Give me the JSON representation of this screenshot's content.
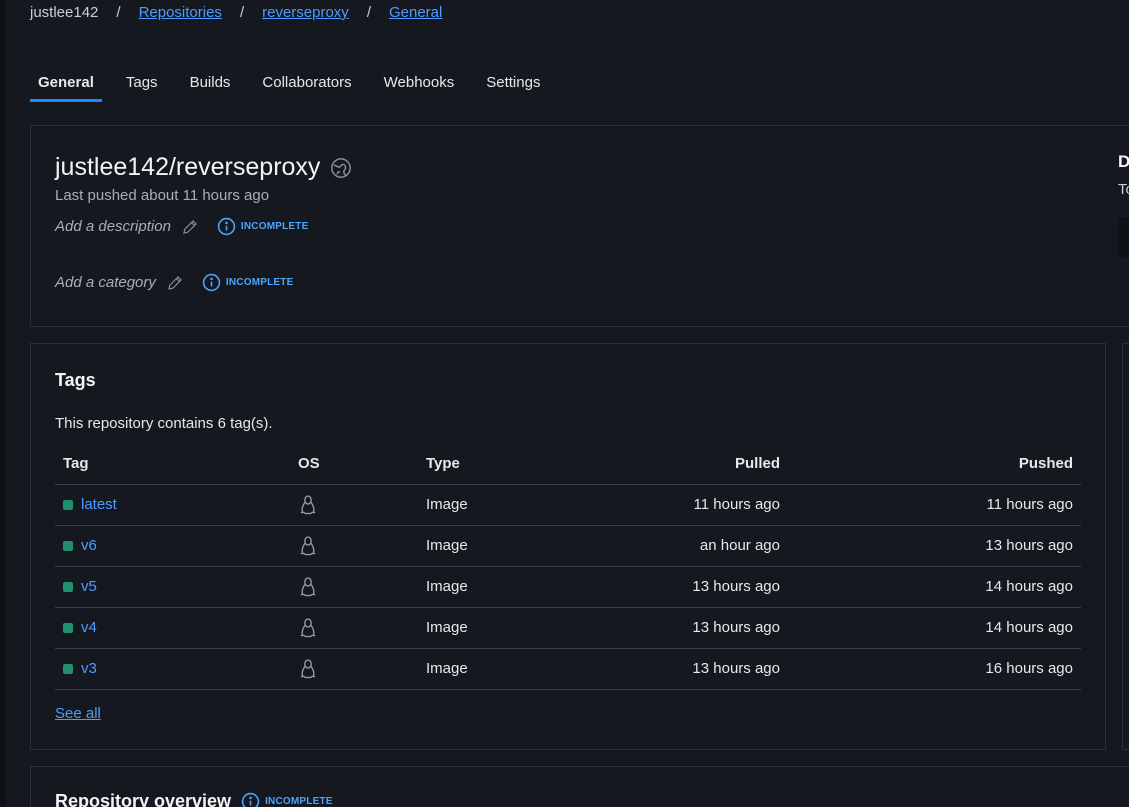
{
  "breadcrumb": {
    "user": "justlee142",
    "sep": "/",
    "repositories": "Repositories",
    "repo": "reverseproxy",
    "current": "General"
  },
  "tabs": [
    {
      "label": "General",
      "active": true
    },
    {
      "label": "Tags"
    },
    {
      "label": "Builds"
    },
    {
      "label": "Collaborators"
    },
    {
      "label": "Webhooks"
    },
    {
      "label": "Settings"
    }
  ],
  "repo": {
    "title": "justlee142/reverseproxy",
    "last_pushed": "Last pushed about 11 hours ago",
    "description_placeholder": "Add a description",
    "category_placeholder": "Add a category",
    "incomplete_label": "INCOMPLETE"
  },
  "side_panel": {
    "heading": "D",
    "sub": "To"
  },
  "tags": {
    "title": "Tags",
    "count_text": "This repository contains 6 tag(s).",
    "columns": [
      "Tag",
      "OS",
      "Type",
      "Pulled",
      "Pushed"
    ],
    "rows": [
      {
        "tag": "latest",
        "os": "linux-icon",
        "type": "Image",
        "pulled": "11 hours ago",
        "pushed": "11 hours ago"
      },
      {
        "tag": "v6",
        "os": "linux-icon",
        "type": "Image",
        "pulled": "an hour ago",
        "pushed": "13 hours ago"
      },
      {
        "tag": "v5",
        "os": "linux-icon",
        "type": "Image",
        "pulled": "13 hours ago",
        "pushed": "14 hours ago"
      },
      {
        "tag": "v4",
        "os": "linux-icon",
        "type": "Image",
        "pulled": "13 hours ago",
        "pushed": "14 hours ago"
      },
      {
        "tag": "v3",
        "os": "linux-icon",
        "type": "Image",
        "pulled": "13 hours ago",
        "pushed": "16 hours ago"
      }
    ],
    "see_all": "See all"
  },
  "overview": {
    "title": "Repository overview",
    "incomplete_label": "INCOMPLETE"
  },
  "colors": {
    "background": "#15191f",
    "accent": "#1d8cf8",
    "link": "#4d9bff",
    "tag_dot": "#1f8f6f"
  }
}
